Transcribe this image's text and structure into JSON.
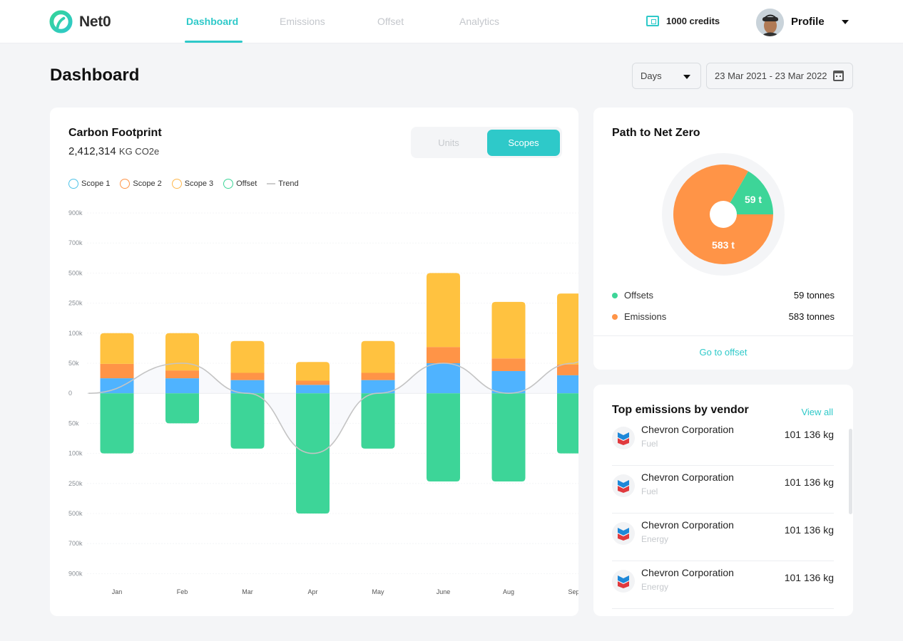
{
  "app": {
    "name": "Net0",
    "brand_color": "#2ec9c9",
    "nav_tabs": [
      {
        "label": "Dashboard",
        "active": true
      },
      {
        "label": "Emissions",
        "active": false
      },
      {
        "label": "Offset",
        "active": false
      },
      {
        "label": "Analytics",
        "active": false
      }
    ],
    "credits": "1000 credits",
    "profile_label": "Profile"
  },
  "page": {
    "title": "Dashboard",
    "period_select": "Days",
    "date_range": "23 Mar 2021 - 23 Mar 2022"
  },
  "carbon_footprint": {
    "title": "Carbon Footprint",
    "total": "2,412,314",
    "unit": "KG CO2e",
    "toggle": {
      "units": "Units",
      "scopes": "Scopes",
      "active": "Scopes"
    },
    "legend": [
      {
        "label": "Scope 1",
        "color": "#4fb3ff"
      },
      {
        "label": "Scope 2",
        "color": "#ff9447"
      },
      {
        "label": "Scope 3",
        "color": "#ffc240"
      },
      {
        "label": "Offset",
        "color": "#3dd598"
      },
      {
        "label": "Trend",
        "color": "#cccccc"
      }
    ]
  },
  "chart_data": {
    "type": "bar",
    "stacked": true,
    "title": "Carbon Footprint",
    "xlabel": "",
    "ylabel": "",
    "categories": [
      "Jan",
      "Feb",
      "Mar",
      "Apr",
      "May",
      "June",
      "Aug",
      "Sep"
    ],
    "y_ticks": [
      900000,
      700000,
      500000,
      250000,
      100000,
      50000,
      0,
      -50000,
      -100000,
      -250000,
      -500000,
      -700000,
      -900000
    ],
    "y_tick_labels": [
      "900k",
      "700k",
      "500k",
      "250k",
      "100k",
      "50k",
      "0",
      "50k",
      "100k",
      "250k",
      "500k",
      "700k",
      "900k"
    ],
    "y_scale": "piecewise (ticks evenly spaced)",
    "ylim": [
      -900000,
      900000
    ],
    "grid": true,
    "legend_position": "top-left",
    "series": [
      {
        "name": "Scope 1",
        "color": "#4fb3ff",
        "values": [
          25000,
          25000,
          22000,
          14000,
          22000,
          50000,
          37000,
          30000
        ]
      },
      {
        "name": "Scope 2",
        "color": "#ff9447",
        "values": [
          24000,
          13000,
          12000,
          7000,
          12000,
          27000,
          21000,
          18000
        ]
      },
      {
        "name": "Scope 3",
        "color": "#ffc240",
        "values": [
          51000,
          62000,
          53000,
          31000,
          53000,
          423000,
          202000,
          282000
        ]
      },
      {
        "name": "Offset",
        "color": "#3dd598",
        "values": [
          -100000,
          -50000,
          -92000,
          -500000,
          -92000,
          -240000,
          -240000,
          -100000
        ]
      }
    ],
    "trend": {
      "name": "Trend",
      "color": "#c4c4c4",
      "values": [
        0,
        50000,
        0,
        -100000,
        0,
        50000,
        0,
        50000
      ]
    }
  },
  "path_to_net_zero": {
    "title": "Path to Net Zero",
    "chart_data": {
      "type": "pie",
      "slices": [
        {
          "label": "Offsets",
          "value": 59,
          "display": "59 t",
          "color": "#3dd598"
        },
        {
          "label": "Emissions",
          "value": 583,
          "display": "583 t",
          "color": "#ff9447"
        }
      ]
    },
    "rows": [
      {
        "label": "Offsets",
        "value": "59 tonnes",
        "color": "#3dd598"
      },
      {
        "label": "Emissions",
        "value": "583 tonnes",
        "color": "#ff9447"
      }
    ],
    "link": "Go to offset"
  },
  "vendors": {
    "title": "Top emissions by vendor",
    "view_all": "View all",
    "items": [
      {
        "name": "Chevron Corporation",
        "category": "Fuel",
        "value": "101 136 kg"
      },
      {
        "name": "Chevron Corporation",
        "category": "Fuel",
        "value": "101 136 kg"
      },
      {
        "name": "Chevron Corporation",
        "category": "Energy",
        "value": "101 136 kg"
      },
      {
        "name": "Chevron Corporation",
        "category": "Energy",
        "value": "101 136 kg"
      }
    ]
  }
}
